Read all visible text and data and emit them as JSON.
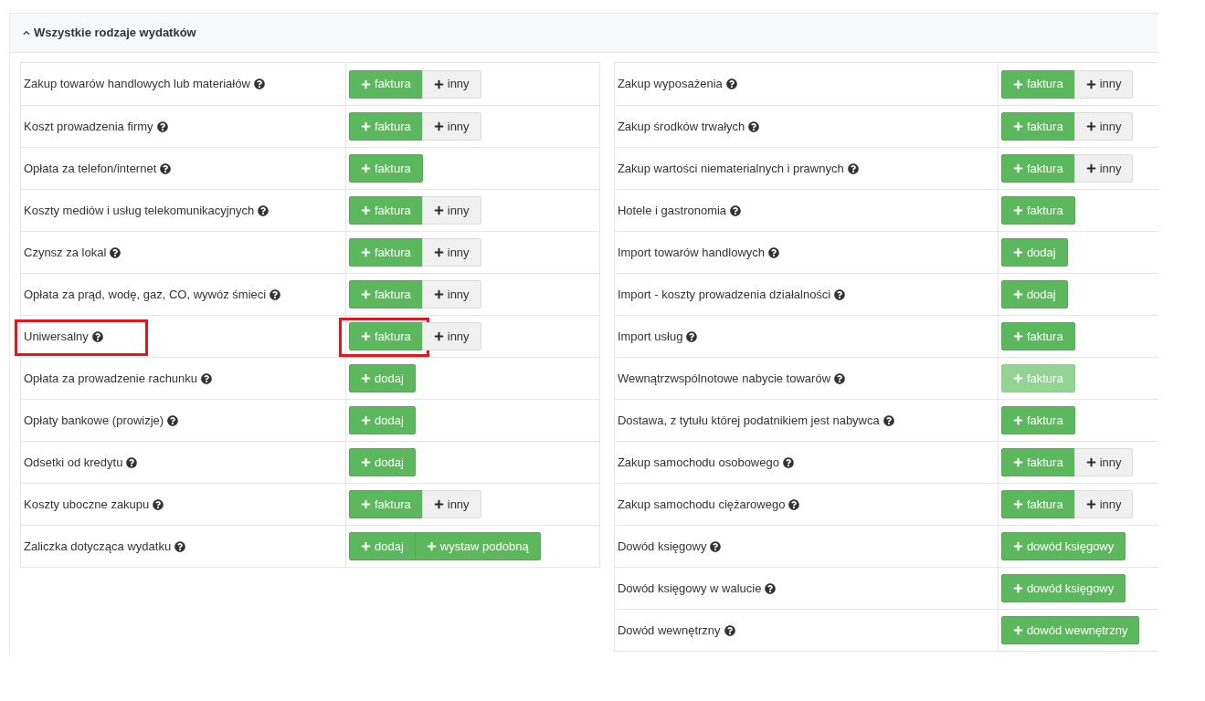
{
  "panel": {
    "title": "Wszystkie rodzaje wydatków",
    "expanded": true
  },
  "tables": [
    {
      "rows": [
        {
          "label": "Zakup towarów handlowych lub materiałów",
          "highlighted": false,
          "buttons": [
            {
              "label": "faktura",
              "kind": "primary",
              "disabled": false
            },
            {
              "label": "inny",
              "kind": "secondary",
              "disabled": false
            }
          ]
        },
        {
          "label": "Koszt prowadzenia firmy",
          "highlighted": false,
          "buttons": [
            {
              "label": "faktura",
              "kind": "primary",
              "disabled": false
            },
            {
              "label": "inny",
              "kind": "secondary",
              "disabled": false
            }
          ]
        },
        {
          "label": "Opłata za telefon/internet",
          "highlighted": false,
          "buttons": [
            {
              "label": "faktura",
              "kind": "primary",
              "disabled": false
            }
          ]
        },
        {
          "label": "Koszty mediów i usług telekomunikacyjnych",
          "highlighted": false,
          "buttons": [
            {
              "label": "faktura",
              "kind": "primary",
              "disabled": false
            },
            {
              "label": "inny",
              "kind": "secondary",
              "disabled": false
            }
          ]
        },
        {
          "label": "Czynsz za lokal",
          "highlighted": false,
          "buttons": [
            {
              "label": "faktura",
              "kind": "primary",
              "disabled": false
            },
            {
              "label": "inny",
              "kind": "secondary",
              "disabled": false
            }
          ]
        },
        {
          "label": "Opłata za prąd, wodę, gaz, CO, wywóz śmieci",
          "highlighted": false,
          "buttons": [
            {
              "label": "faktura",
              "kind": "primary",
              "disabled": false
            },
            {
              "label": "inny",
              "kind": "secondary",
              "disabled": false
            }
          ]
        },
        {
          "label": "Uniwersalny",
          "highlighted": true,
          "buttons": [
            {
              "label": "faktura",
              "kind": "primary",
              "disabled": false
            },
            {
              "label": "inny",
              "kind": "secondary",
              "disabled": false
            }
          ]
        },
        {
          "label": "Opłata za prowadzenie rachunku",
          "highlighted": false,
          "buttons": [
            {
              "label": "dodaj",
              "kind": "primary",
              "disabled": false
            }
          ]
        },
        {
          "label": "Opłaty bankowe (prowizje)",
          "highlighted": false,
          "buttons": [
            {
              "label": "dodaj",
              "kind": "primary",
              "disabled": false
            }
          ]
        },
        {
          "label": "Odsetki od kredytu",
          "highlighted": false,
          "buttons": [
            {
              "label": "dodaj",
              "kind": "primary",
              "disabled": false
            }
          ]
        },
        {
          "label": "Koszty uboczne zakupu",
          "highlighted": false,
          "buttons": [
            {
              "label": "faktura",
              "kind": "primary",
              "disabled": false
            },
            {
              "label": "inny",
              "kind": "secondary",
              "disabled": false
            }
          ]
        },
        {
          "label": "Zaliczka dotycząca wydatku",
          "highlighted": false,
          "buttons": [
            {
              "label": "dodaj",
              "kind": "primary",
              "disabled": false
            },
            {
              "label": "wystaw podobną",
              "kind": "primary",
              "disabled": false
            }
          ]
        }
      ]
    },
    {
      "rows": [
        {
          "label": "Zakup wyposażenia",
          "highlighted": false,
          "buttons": [
            {
              "label": "faktura",
              "kind": "primary",
              "disabled": false
            },
            {
              "label": "inny",
              "kind": "secondary",
              "disabled": false
            }
          ]
        },
        {
          "label": "Zakup środków trwałych",
          "highlighted": false,
          "buttons": [
            {
              "label": "faktura",
              "kind": "primary",
              "disabled": false
            },
            {
              "label": "inny",
              "kind": "secondary",
              "disabled": false
            }
          ]
        },
        {
          "label": "Zakup wartości niematerialnych i prawnych",
          "highlighted": false,
          "buttons": [
            {
              "label": "faktura",
              "kind": "primary",
              "disabled": false
            },
            {
              "label": "inny",
              "kind": "secondary",
              "disabled": false
            }
          ]
        },
        {
          "label": "Hotele i gastronomia",
          "highlighted": false,
          "buttons": [
            {
              "label": "faktura",
              "kind": "primary",
              "disabled": false
            }
          ]
        },
        {
          "label": "Import towarów handlowych",
          "highlighted": false,
          "buttons": [
            {
              "label": "dodaj",
              "kind": "primary",
              "disabled": false
            }
          ]
        },
        {
          "label": "Import - koszty prowadzenia działalności",
          "highlighted": false,
          "buttons": [
            {
              "label": "dodaj",
              "kind": "primary",
              "disabled": false
            }
          ]
        },
        {
          "label": "Import usług",
          "highlighted": false,
          "buttons": [
            {
              "label": "faktura",
              "kind": "primary",
              "disabled": false
            }
          ]
        },
        {
          "label": "Wewnątrzwspólnotowe nabycie towarów",
          "highlighted": false,
          "buttons": [
            {
              "label": "faktura",
              "kind": "primary",
              "disabled": true
            }
          ]
        },
        {
          "label": "Dostawa, z tytułu której podatnikiem jest nabywca",
          "highlighted": false,
          "buttons": [
            {
              "label": "faktura",
              "kind": "primary",
              "disabled": false
            }
          ]
        },
        {
          "label": "Zakup samochodu osobowego",
          "highlighted": false,
          "buttons": [
            {
              "label": "faktura",
              "kind": "primary",
              "disabled": false
            },
            {
              "label": "inny",
              "kind": "secondary",
              "disabled": false
            }
          ]
        },
        {
          "label": "Zakup samochodu ciężarowego",
          "highlighted": false,
          "buttons": [
            {
              "label": "faktura",
              "kind": "primary",
              "disabled": false
            },
            {
              "label": "inny",
              "kind": "secondary",
              "disabled": false
            }
          ]
        },
        {
          "label": "Dowód księgowy",
          "highlighted": false,
          "buttons": [
            {
              "label": "dowód księgowy",
              "kind": "primary",
              "disabled": false
            }
          ]
        },
        {
          "label": "Dowód księgowy w walucie",
          "highlighted": false,
          "buttons": [
            {
              "label": "dowód księgowy",
              "kind": "primary",
              "disabled": false
            }
          ]
        },
        {
          "label": "Dowód wewnętrzny",
          "highlighted": false,
          "buttons": [
            {
              "label": "dowód wewnętrzny",
              "kind": "primary",
              "disabled": false
            }
          ]
        }
      ]
    }
  ]
}
